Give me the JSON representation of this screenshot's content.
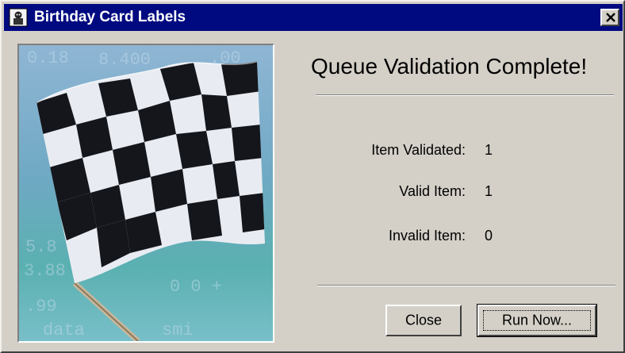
{
  "window": {
    "title": "Birthday Card Labels",
    "title_icon": "app-icon",
    "close_icon": "close-icon"
  },
  "image": {
    "description_icon": "checkered-flag-image"
  },
  "main": {
    "heading": "Queue Validation Complete!",
    "stats": [
      {
        "label": "Item Validated:",
        "value": "1"
      },
      {
        "label": "Valid Item:",
        "value": "1"
      },
      {
        "label": "Invalid Item:",
        "value": "0"
      }
    ]
  },
  "buttons": {
    "close_label": "Close",
    "run_now_label": "Run Now..."
  },
  "colors": {
    "titlebar": "#000a80",
    "dialog_face": "#d4d0c8"
  }
}
